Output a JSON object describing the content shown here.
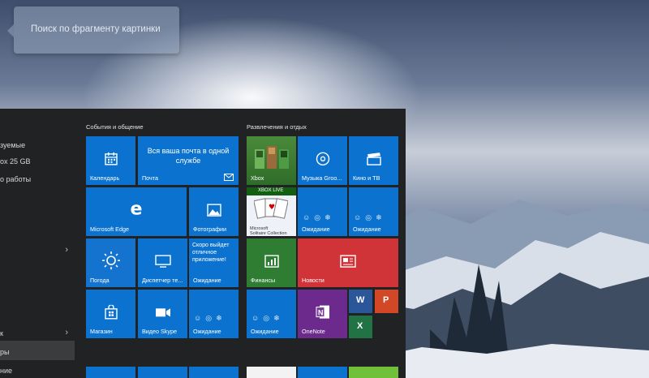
{
  "search_bubble": {
    "text": "Поиск по фрагменту картинки"
  },
  "sidebar": {
    "items": [
      {
        "label": "зуемые"
      },
      {
        "label": "ox 25 GB"
      },
      {
        "label": "о работы"
      },
      {
        "label": "к"
      },
      {
        "label": "ры"
      },
      {
        "label": "ние"
      }
    ]
  },
  "groups": {
    "left_title": "События и общение",
    "right_title": "Развлечения и отдых"
  },
  "tiles": {
    "calendar": "Календарь",
    "mail_text": "Вся ваша почта в одной службе",
    "mail": "Почта",
    "xbox": "Xbox",
    "xbox_live": "XBOX LIVE",
    "groove": "Музыка Groo...",
    "movies": "Кино и ТВ",
    "edge": "Microsoft Edge",
    "photos": "Фотографии",
    "solitaire_line1": "Microsoft",
    "solitaire_line2": "Solitaire Collection",
    "waiting1": "Ожидание",
    "waiting2": "Ожидание",
    "weather": "Погода",
    "task_manager": "Диспетчер те...",
    "promo_text": "Скоро выйдет отличное приложение!",
    "waiting3": "Ожидание",
    "finance": "Финансы",
    "news": "Новости",
    "store": "Магазин",
    "skype": "Видео Skype",
    "waiting4": "Ожидание",
    "waiting5": "Ожидание",
    "onenote": "OneNote"
  },
  "colors": {
    "tile_blue": "#0b73cf",
    "finance_green": "#2e7d32",
    "news_red": "#d13438",
    "onenote_purple": "#6b2a8c",
    "menu_bg": "#202224"
  }
}
